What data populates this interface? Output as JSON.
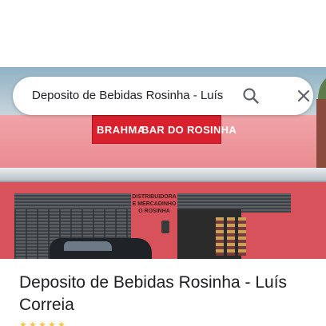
{
  "search": {
    "query": "Deposito de Bebidas Rosinha - Luís"
  },
  "icons": {
    "search": "search-icon",
    "close": "close-icon",
    "star": "star-icon"
  },
  "photo": {
    "sign_left": "BRAHMA",
    "sign_right": "BAR DO ROSINHA",
    "storefront_text": "DISTRIBUIDORA\nE MERCADINHO\nO ROSINHA"
  },
  "place": {
    "title": "Deposito de Bebidas Rosinha - Luís Correia"
  },
  "colors": {
    "sign_red": "#d8212d",
    "facade_pink": "#ea8a90",
    "star_yellow": "#f4c542",
    "text_dark": "#202124"
  }
}
